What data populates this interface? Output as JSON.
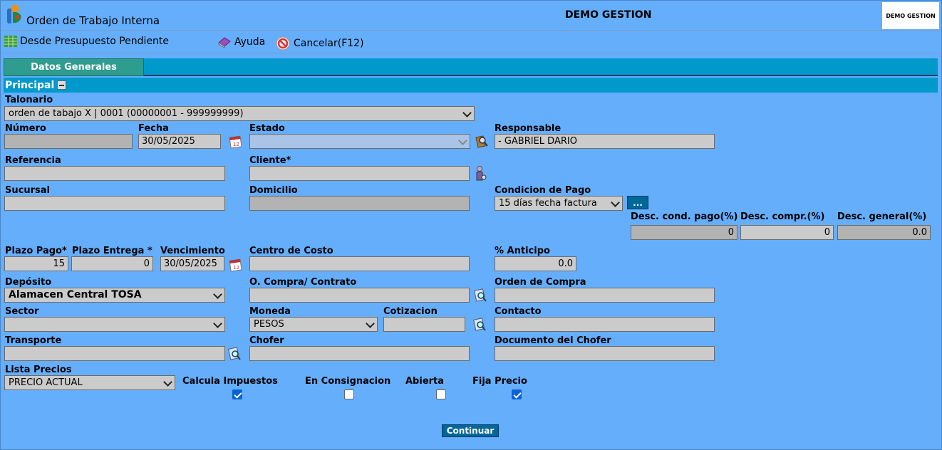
{
  "header": {
    "title": "Orden de Trabajo Interna",
    "company": "DEMO GESTION",
    "logo_text": "DEMO GESTION"
  },
  "toolbar": {
    "from_budget": "Desde Presupuesto Pendiente",
    "help": "Ayuda",
    "cancel": "Cancelar(F12)"
  },
  "tabs": {
    "general": "Datos Generales"
  },
  "section": {
    "principal": "Principal"
  },
  "fields": {
    "talonario": {
      "label": "Talonario",
      "value": "orden de tabajo X | 0001 (00000001 - 999999999)"
    },
    "numero": {
      "label": "Número",
      "value": ""
    },
    "fecha": {
      "label": "Fecha",
      "value": "30/05/2025"
    },
    "estado": {
      "label": "Estado",
      "value": ""
    },
    "responsable": {
      "label": "Responsable",
      "value": "- GABRIEL DARIO"
    },
    "referencia": {
      "label": "Referencia",
      "value": ""
    },
    "cliente": {
      "label": "Cliente*",
      "value": ""
    },
    "sucursal": {
      "label": "Sucursal",
      "value": ""
    },
    "domicilio": {
      "label": "Domicilio",
      "value": ""
    },
    "condicion_pago": {
      "label": "Condicion de Pago",
      "value": "15 días fecha factura",
      "button": "..."
    },
    "desc_cond_pago": {
      "label": "Desc. cond. pago(%)",
      "value": "0"
    },
    "desc_compr": {
      "label": "Desc. compr.(%)",
      "value": "0"
    },
    "desc_general": {
      "label": "Desc. general(%)",
      "value": "0.0"
    },
    "plazo_pago": {
      "label": "Plazo Pago*",
      "value": "15"
    },
    "plazo_entrega": {
      "label": "Plazo Entrega *",
      "value": "0"
    },
    "vencimiento": {
      "label": "Vencimiento",
      "value": "30/05/2025"
    },
    "centro_costo": {
      "label": "Centro de Costo",
      "value": ""
    },
    "anticipo": {
      "label": "% Anticipo",
      "value": "0.0"
    },
    "deposito": {
      "label": "Depósito",
      "value": "Alamacen Central TOSA"
    },
    "o_compra_contrato": {
      "label": "O. Compra/ Contrato",
      "value": ""
    },
    "orden_compra": {
      "label": "Orden de Compra",
      "value": ""
    },
    "sector": {
      "label": "Sector",
      "value": ""
    },
    "moneda": {
      "label": "Moneda",
      "value": "PESOS"
    },
    "cotizacion": {
      "label": "Cotizacion",
      "value": ""
    },
    "contacto": {
      "label": "Contacto",
      "value": ""
    },
    "transporte": {
      "label": "Transporte",
      "value": ""
    },
    "chofer": {
      "label": "Chofer",
      "value": ""
    },
    "documento_chofer": {
      "label": "Documento del Chofer",
      "value": ""
    },
    "lista_precios": {
      "label": "Lista Precios",
      "value": "PRECIO ACTUAL"
    },
    "calcula_impuestos": {
      "label": "Calcula Impuestos",
      "checked": true
    },
    "en_consignacion": {
      "label": "En Consignacion",
      "checked": false
    },
    "abierta": {
      "label": "Abierta",
      "checked": false
    },
    "fija_precio": {
      "label": "Fija Precio",
      "checked": true
    }
  },
  "actions": {
    "continue": "Continuar"
  },
  "colors": {
    "background": "#65aefc",
    "section_bar": "#0099cc",
    "tab": "#2e9c8e",
    "button": "#006799",
    "input": "#cbcbcb"
  }
}
